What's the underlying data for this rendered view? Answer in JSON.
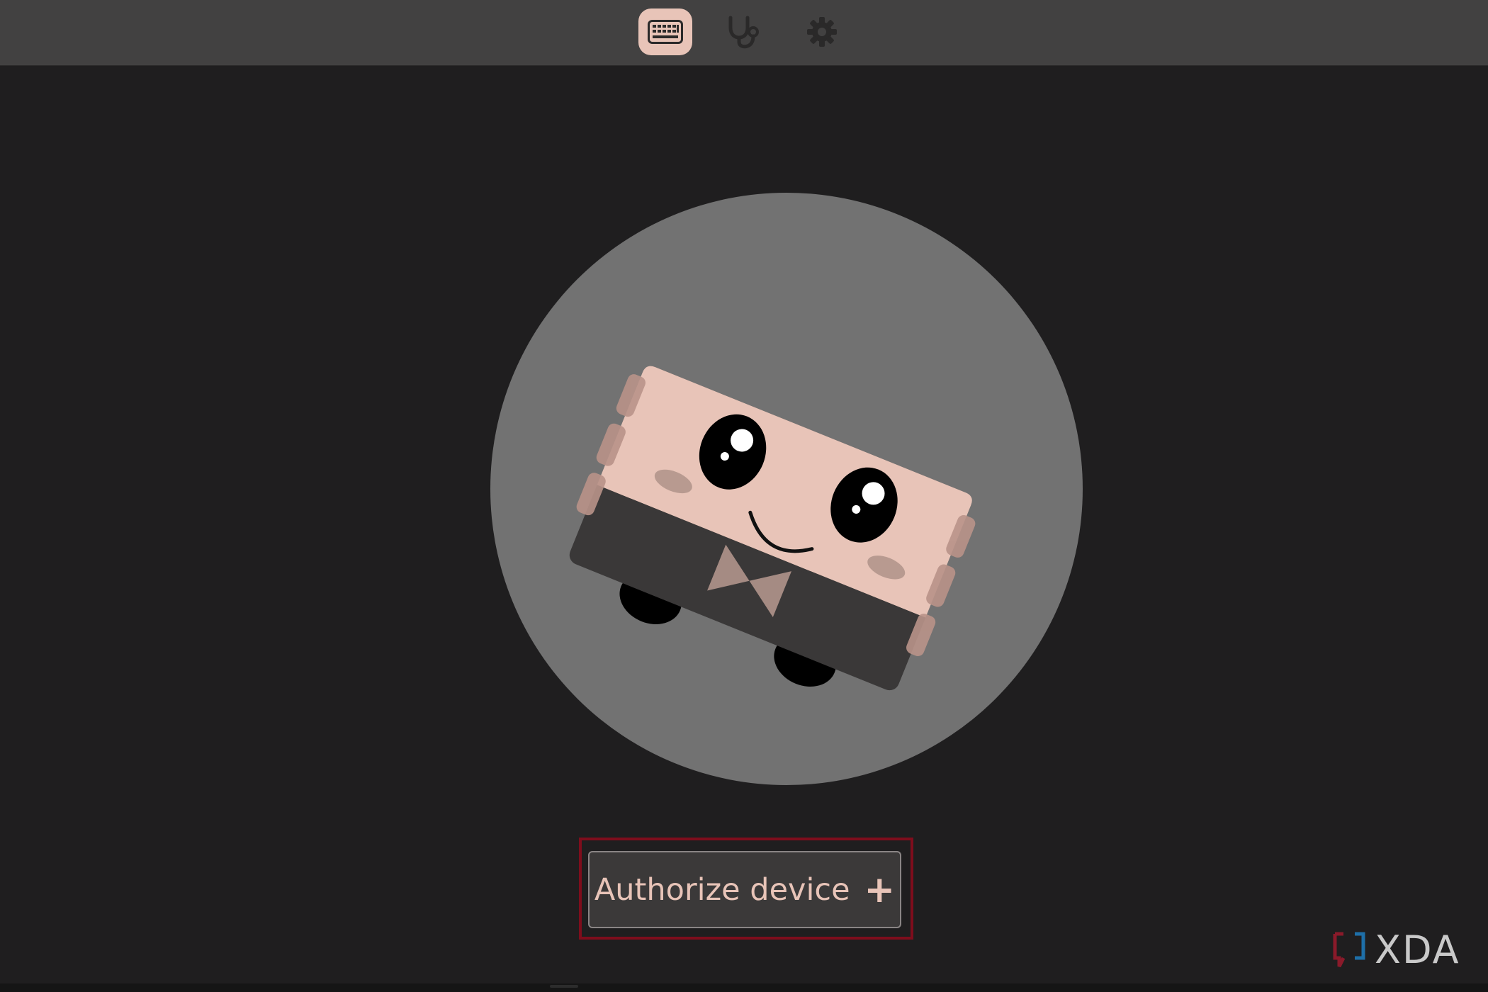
{
  "nav": {
    "tabs": [
      {
        "icon": "keyboard-icon",
        "active": true
      },
      {
        "icon": "stethoscope-icon",
        "active": false
      },
      {
        "icon": "gear-icon",
        "active": false
      }
    ]
  },
  "main": {
    "authorize_label": "Authorize device",
    "authorize_icon": "plus-icon",
    "plus_glyph": "+"
  },
  "watermark": {
    "text": "XDA"
  },
  "colors": {
    "background": "#1f1e1f",
    "topbar": "#424141",
    "accent": "#e8c4b8",
    "highlight": "#7e0d1c",
    "circle": "#727272",
    "mascot_body": "#e8c4b8",
    "mascot_base": "#3a3838"
  }
}
